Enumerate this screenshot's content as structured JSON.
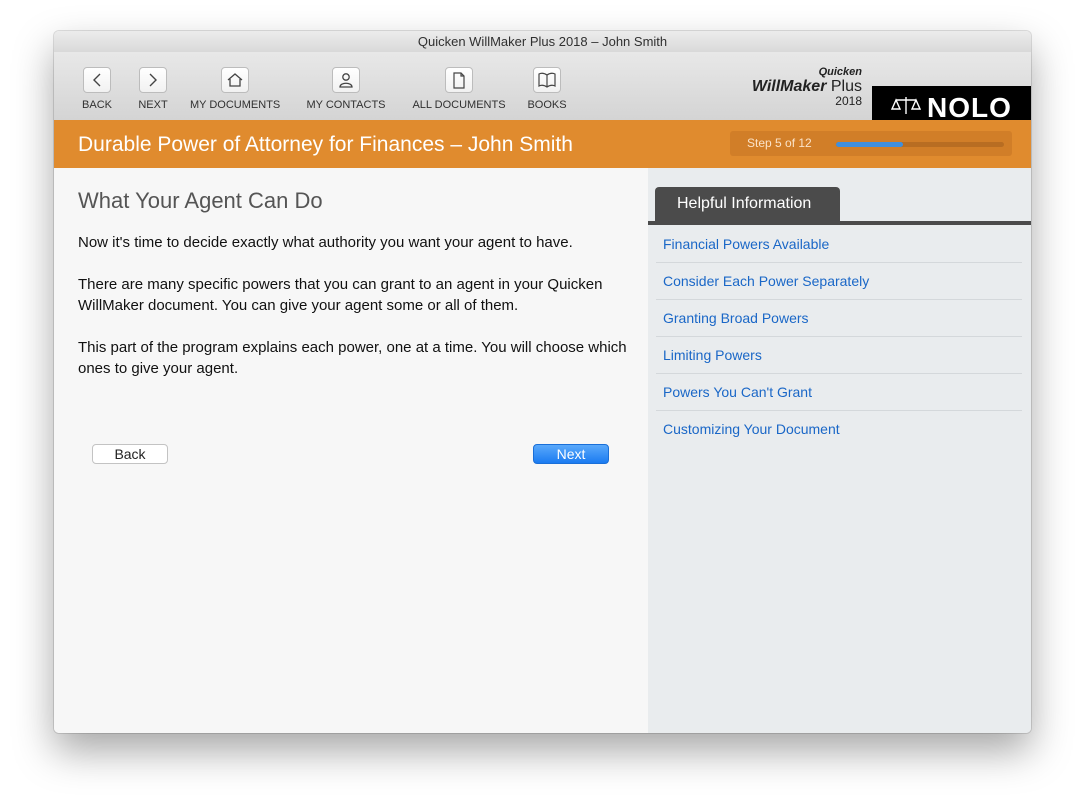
{
  "window": {
    "title": "Quicken WillMaker Plus 2018 – John Smith"
  },
  "toolbar": {
    "items": [
      {
        "label": "BACK",
        "icon": "chevron-left-icon"
      },
      {
        "label": "NEXT",
        "icon": "chevron-right-icon"
      },
      {
        "label": "MY DOCUMENTS",
        "icon": "home-icon"
      },
      {
        "label": "MY CONTACTS",
        "icon": "person-icon"
      },
      {
        "label": "ALL DOCUMENTS",
        "icon": "document-icon"
      },
      {
        "label": "BOOKS",
        "icon": "book-icon"
      }
    ]
  },
  "brand": {
    "line1": "Quicken",
    "line2_bold": "WillMaker",
    "line2_rest": " Plus",
    "line3": "2018",
    "nolo": "NOLO",
    "nolo_icon": "scales-icon"
  },
  "header": {
    "doc_title": "Durable Power of Attorney for Finances – John Smith",
    "step_text": "Step 5 of 12",
    "progress_fraction": 0.4,
    "accent_color": "#e08b2e",
    "progress_color": "#3f8fde"
  },
  "main": {
    "heading": "What Your Agent Can Do",
    "paragraphs": [
      "Now it's time to decide exactly what authority you want your agent to have.",
      "There are many specific powers that you can grant to an agent in your Quicken WillMaker document. You can give your agent some or all of them.",
      "This part of the program explains each power, one at a time. You will choose which ones to give your agent."
    ],
    "back_label": "Back",
    "next_label": "Next"
  },
  "sidebar": {
    "tab_label": "Helpful Information",
    "links": [
      "Financial Powers Available",
      "Consider Each Power Separately",
      "Granting Broad Powers",
      "Limiting Powers",
      "Powers You Can't Grant",
      "Customizing Your Document"
    ]
  }
}
